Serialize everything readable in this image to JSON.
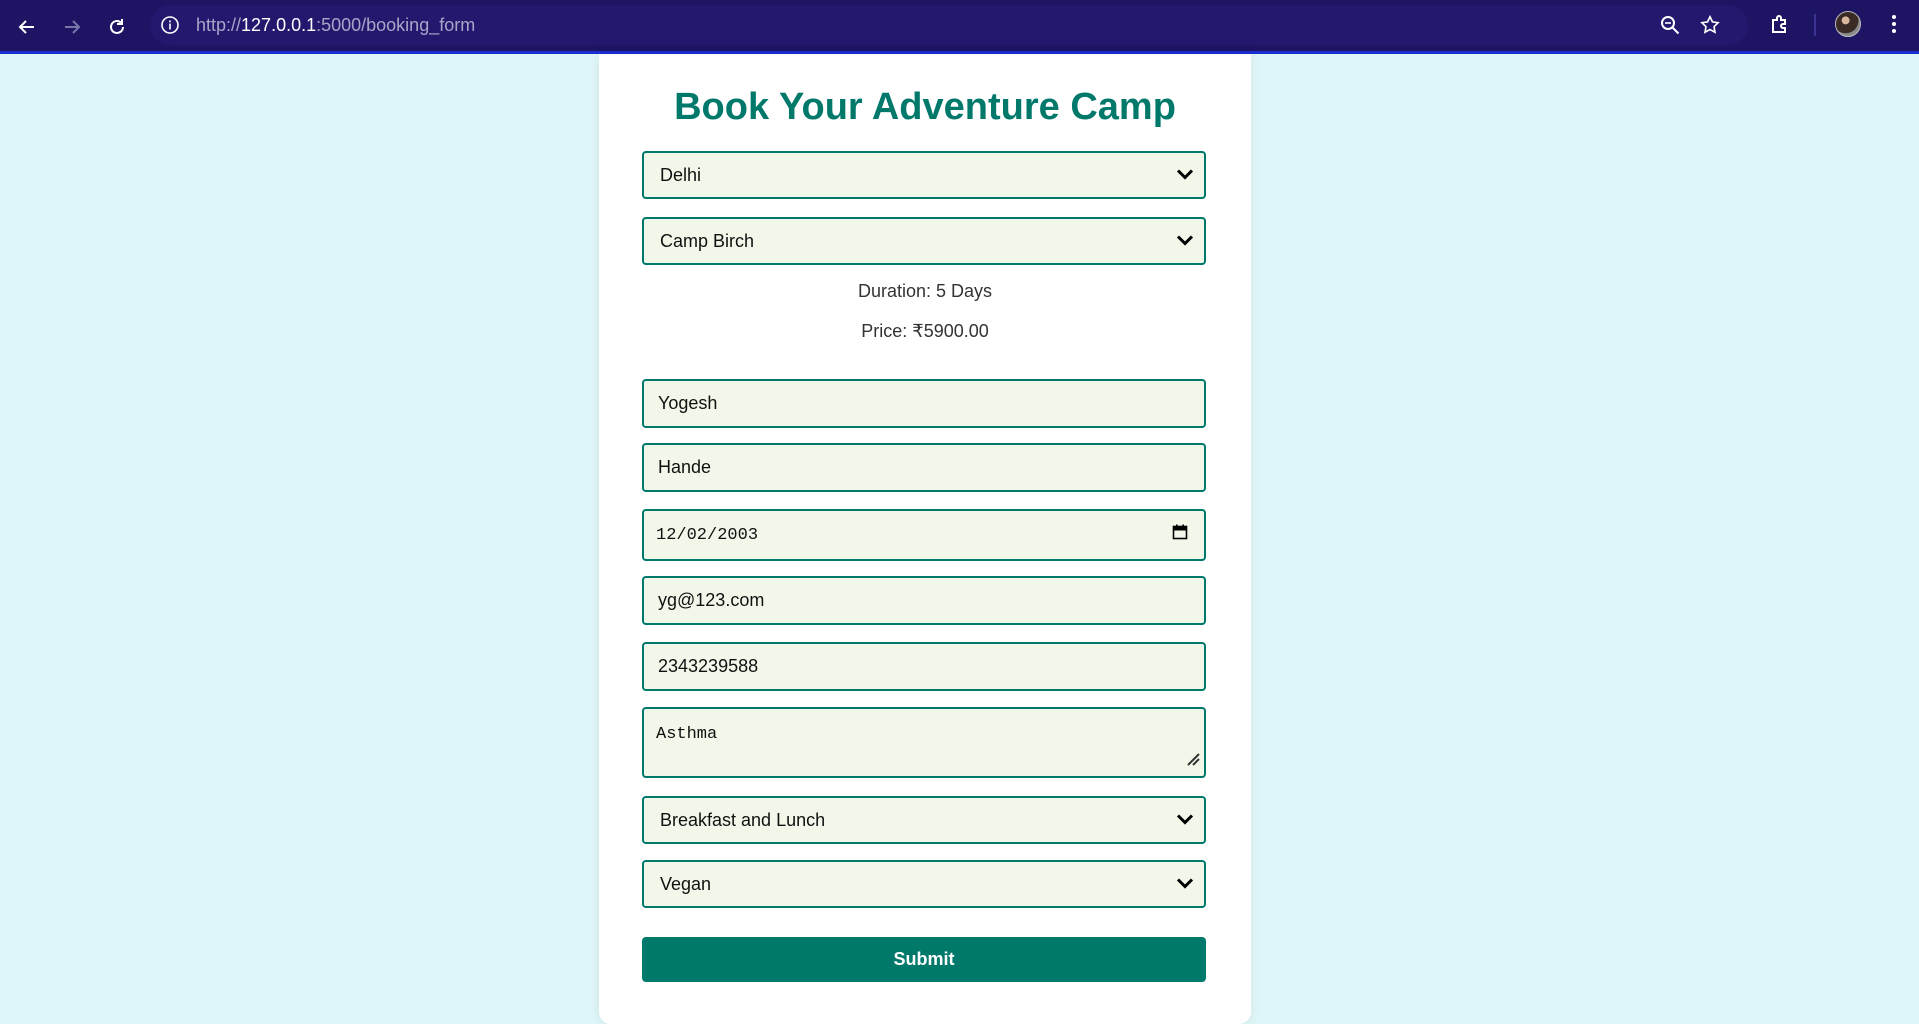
{
  "browser": {
    "url_scheme": "http://",
    "url_host": "127.0.0.1",
    "url_path": ":5000/booking_form",
    "icons": [
      "back-arrow-icon",
      "forward-arrow-icon",
      "reload-icon",
      "site-info-icon",
      "zoom-icon",
      "bookmark-star-icon",
      "extensions-icon",
      "profile-avatar",
      "more-vertical-icon"
    ]
  },
  "form": {
    "title": "Book Your Adventure Camp",
    "location_select": "Delhi",
    "camp_select": "Camp Birch",
    "duration_text": "Duration: 5 Days",
    "price_text": "Price: ₹5900.00",
    "first_name": "Yogesh",
    "last_name": "Hande",
    "dob": "12/02/2003",
    "email": "yg@123.com",
    "phone": "2343239588",
    "medical_notes": "Asthma",
    "meal_plan_select": "Breakfast and Lunch",
    "diet_select": "Vegan",
    "submit_label": "Submit"
  },
  "colors": {
    "accent": "#00796b",
    "field_bg": "#f1f8e9",
    "page_bg": "#dff6f8",
    "chrome_bg": "#1d1564"
  }
}
